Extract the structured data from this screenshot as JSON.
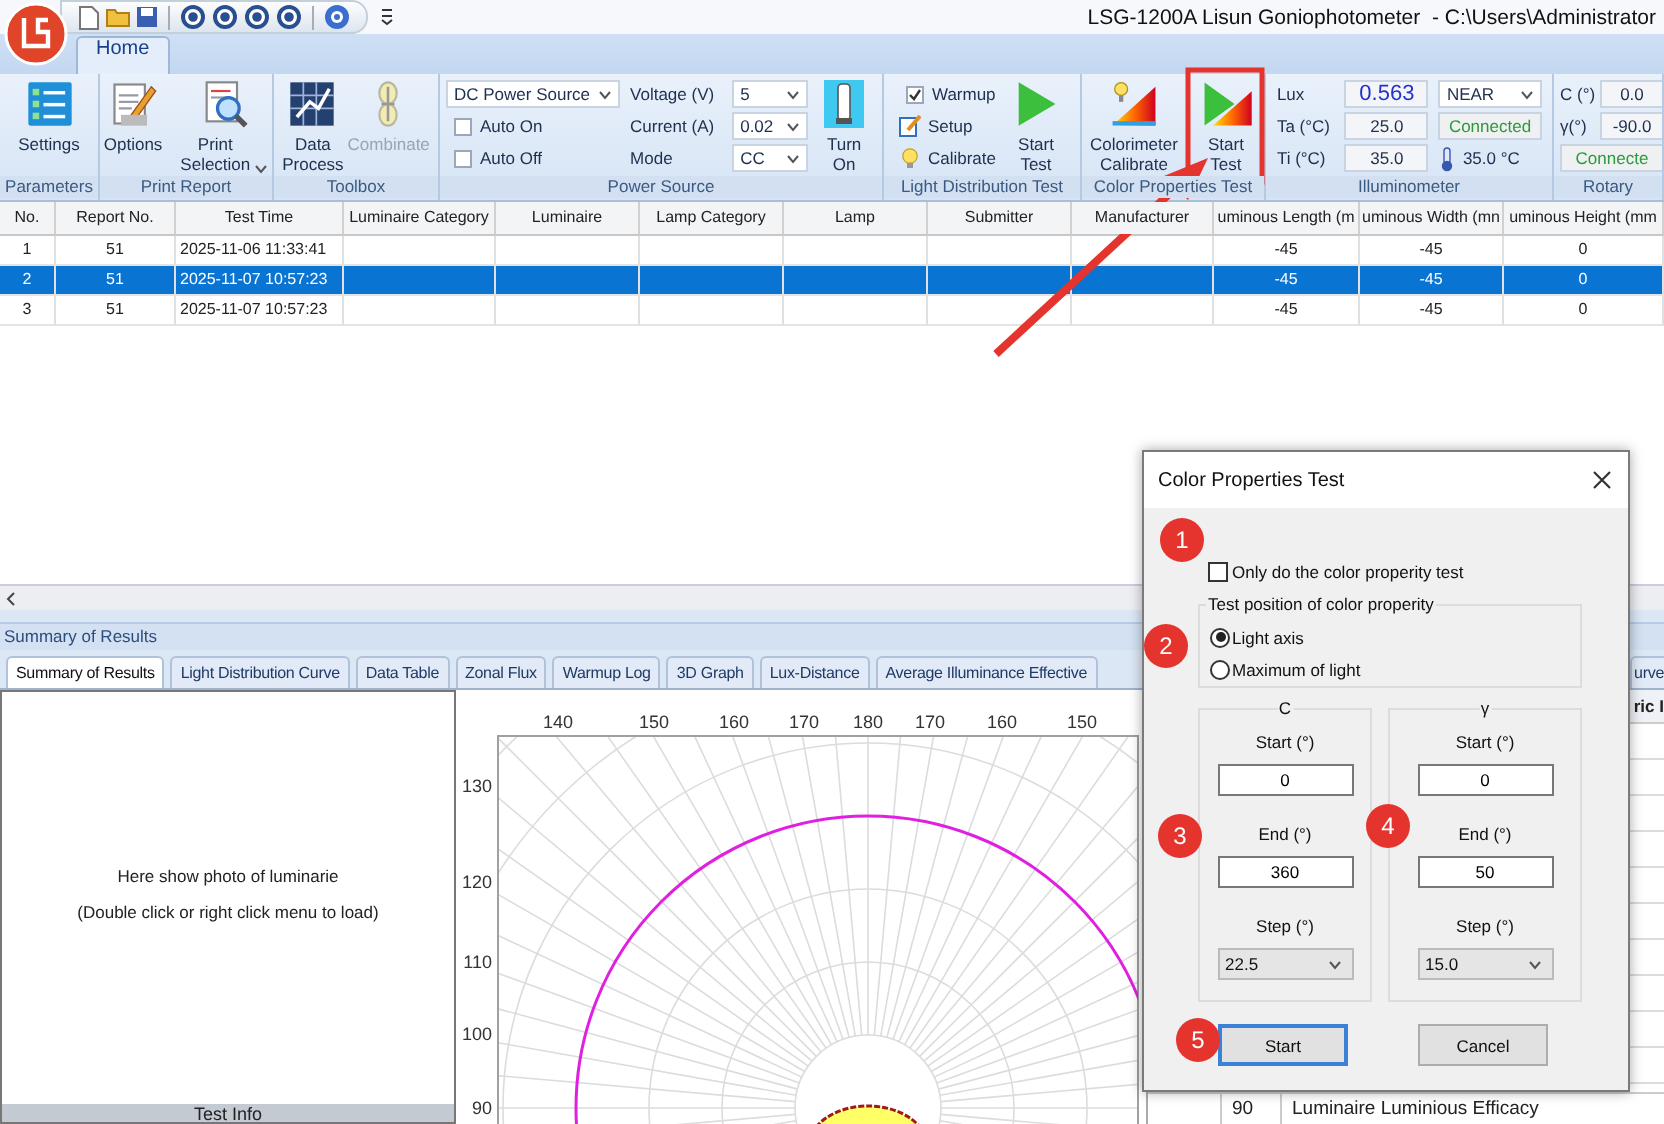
{
  "window": {
    "title": "LSG-1200A Lisun Goniophotometer  - C:\\Users\\Administrator"
  },
  "ribbon_tabs": [
    {
      "label": "Home",
      "selected": true
    }
  ],
  "ribbon": {
    "groups": [
      {
        "label": "Parameters",
        "items": [
          {
            "kind": "big",
            "label": "Settings",
            "disabled": false,
            "dropdown": false
          }
        ]
      },
      {
        "label": "Print Report",
        "items": [
          {
            "kind": "big",
            "label": "Options",
            "disabled": false,
            "dropdown": false
          },
          {
            "kind": "big",
            "label": "Print Selection",
            "disabled": false,
            "dropdown": true
          }
        ]
      },
      {
        "label": "Toolbox",
        "items": [
          {
            "kind": "big",
            "label": "Data Process",
            "disabled": false,
            "dropdown": false
          },
          {
            "kind": "big",
            "label": "Combinate",
            "disabled": true,
            "dropdown": false
          }
        ]
      },
      {
        "label": "Power Source",
        "items": [
          {
            "kind": "stack",
            "rows": [
              {
                "kind": "dropdown",
                "value": "DC Power Source"
              },
              {
                "kind": "checkbox",
                "label": "Auto On",
                "checked": false
              },
              {
                "kind": "checkbox",
                "label": "Auto Off",
                "checked": false
              }
            ]
          },
          {
            "kind": "stack",
            "rows": [
              {
                "kind": "text",
                "label": "Voltage (V)"
              },
              {
                "kind": "text",
                "label": "Current (A)"
              },
              {
                "kind": "text",
                "label": "Mode"
              }
            ]
          },
          {
            "kind": "stack",
            "rows": [
              {
                "kind": "dropdown",
                "value": "5"
              },
              {
                "kind": "dropdown",
                "value": "0.02"
              },
              {
                "kind": "dropdown",
                "value": "CC"
              }
            ]
          },
          {
            "kind": "big",
            "label": "Turn On",
            "disabled": false,
            "dropdown": false
          }
        ]
      },
      {
        "label": "Light Distribution Test",
        "items": [
          {
            "kind": "stack",
            "rows": [
              {
                "kind": "checkbox",
                "label": "Warmup",
                "checked": true
              },
              {
                "kind": "tool",
                "label": "Setup"
              },
              {
                "kind": "tool",
                "label": "Calibrate"
              }
            ]
          },
          {
            "kind": "big",
            "label": "Start Test",
            "disabled": false,
            "dropdown": false
          }
        ]
      },
      {
        "label": "Color Properties Test",
        "items": [
          {
            "kind": "big",
            "label": "Colorimeter Calibrate",
            "disabled": false,
            "dropdown": false
          },
          {
            "kind": "big",
            "label": "Start Test",
            "disabled": false,
            "dropdown": false
          }
        ]
      },
      {
        "label": "Illuminometer",
        "items": [
          {
            "kind": "stack",
            "rows": [
              {
                "kind": "pair",
                "label": "Lux",
                "value": "0.563",
                "highlight": true
              },
              {
                "kind": "pair",
                "label": "Ta (°C)",
                "value": "25.0",
                "highlight": false
              },
              {
                "kind": "pair",
                "label": "Ti (°C)",
                "value": "35.0",
                "highlight": false
              }
            ]
          },
          {
            "kind": "stack",
            "rows": [
              {
                "kind": "dropdown",
                "value": "NEAR"
              },
              {
                "kind": "status",
                "value": "Connected"
              },
              {
                "kind": "tool",
                "label": "35.0 °C"
              }
            ]
          }
        ]
      },
      {
        "label": "Rotary",
        "items": [
          {
            "kind": "stack",
            "rows": [
              {
                "kind": "pair",
                "label": "C (°)",
                "value": "0.0",
                "highlight": false
              },
              {
                "kind": "pair",
                "label": "γ(°)",
                "value": "-90.0",
                "highlight": false
              },
              {
                "kind": "status",
                "value": "Connecte"
              }
            ]
          }
        ]
      }
    ]
  },
  "table": {
    "columns": [
      "No.",
      "Report No.",
      "Test Time",
      "Luminaire Category",
      "Luminaire",
      "Lamp Category",
      "Lamp",
      "Submitter",
      "Manufacturer",
      "uminous Length (m",
      "uminous Width (mn",
      "uminous Height (mm"
    ],
    "rows": [
      {
        "selected": false,
        "cells": [
          "1",
          "51",
          "2025-11-06 11:33:41",
          null,
          null,
          null,
          null,
          null,
          null,
          "-45",
          "-45",
          "0"
        ]
      },
      {
        "selected": true,
        "cells": [
          "2",
          "51",
          "2025-11-07 10:57:23",
          null,
          null,
          null,
          null,
          null,
          null,
          "-45",
          "-45",
          "0"
        ]
      },
      {
        "selected": false,
        "cells": [
          "3",
          "51",
          "2025-11-07 10:57:23",
          null,
          null,
          null,
          null,
          null,
          null,
          "-45",
          "-45",
          "0"
        ]
      }
    ]
  },
  "results": {
    "title": "Summary of Results",
    "tabs": [
      {
        "label": "Summary of Results",
        "selected": true
      },
      {
        "label": "Light Distribution Curve",
        "selected": false
      },
      {
        "label": "Data Table",
        "selected": false
      },
      {
        "label": "Zonal Flux",
        "selected": false
      },
      {
        "label": "Warmup Log",
        "selected": false
      },
      {
        "label": "3D Graph",
        "selected": false
      },
      {
        "label": "Lux-Distance",
        "selected": false
      },
      {
        "label": "Average Illuminance Effective",
        "selected": false
      },
      {
        "label": "urve",
        "selected": false
      }
    ],
    "photo_panel": {
      "message": "Here show photo of luminarie",
      "hint": "(Double click or right click menu to load)",
      "footer": "Test Info"
    },
    "polar_chart": {
      "top_labels": [
        "140",
        "150",
        "160",
        "170",
        "180",
        "170",
        "160",
        "150"
      ],
      "side_labels": [
        "130",
        "120",
        "110",
        "100",
        "90"
      ]
    },
    "side_table": {
      "header": "ric I",
      "rows": [
        {
          "number": "90",
          "label": "Luminaire Luminious Efficacy"
        }
      ]
    }
  },
  "dialog": {
    "title": "Color Properties Test",
    "only_color_test": {
      "label": "Only do the color properity test",
      "checked": false
    },
    "position_group": {
      "title": "Test position of color properity",
      "options": [
        {
          "label": "Light axis",
          "selected": true
        },
        {
          "label": "Maximum of light",
          "selected": false
        }
      ]
    },
    "axes": [
      {
        "title": "C",
        "start_label": "Start (°)",
        "start": "0",
        "end_label": "End (°)",
        "end": "360",
        "step_label": "Step (°)",
        "step": "22.5"
      },
      {
        "title": "γ",
        "start_label": "Start (°)",
        "start": "0",
        "end_label": "End (°)",
        "end": "50",
        "step_label": "Step (°)",
        "step": "15.0"
      }
    ],
    "buttons": [
      {
        "label": "Start",
        "focused": true
      },
      {
        "label": "Cancel",
        "focused": false
      }
    ]
  },
  "annotations": [
    {
      "number": "1"
    },
    {
      "number": "2"
    },
    {
      "number": "3"
    },
    {
      "number": "4"
    },
    {
      "number": "5"
    }
  ]
}
